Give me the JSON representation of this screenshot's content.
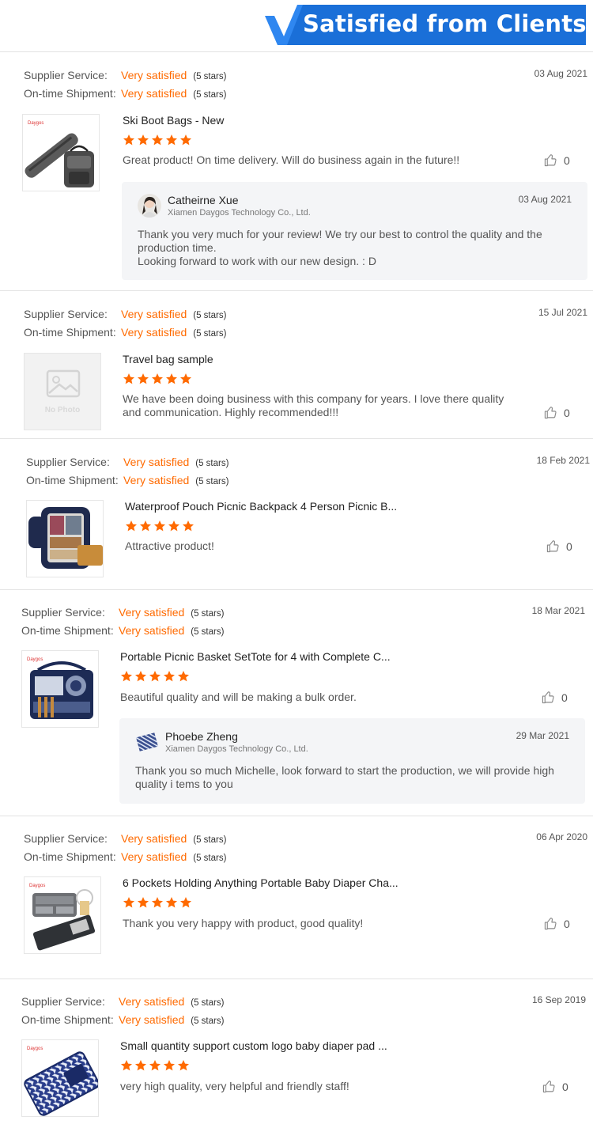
{
  "header": {
    "title": "Satisfied from Clients",
    "accent": "#1a6fd8"
  },
  "labels": {
    "supplier": "Supplier Service:",
    "shipment": "On-time Shipment:"
  },
  "reviews": [
    {
      "supplier_value": "Very satisfied",
      "supplier_count": "(5 stars)",
      "shipment_value": "Very satisfied",
      "shipment_count": "(5 stars)",
      "date": "03 Aug 2021",
      "product": "Ski Boot Bags - New",
      "rating": 5,
      "comment": "Great product! On time delivery. Will do business again in the future!!",
      "likes": "0",
      "reply": {
        "name": "Catheirne Xue",
        "company": "Xiamen Daygos Technology Co., Ltd.",
        "date": "03 Aug 2021",
        "text": "Thank you very much for your review! We try our best to control the quality and the production time.\nLooking forward to work with our new design. : D"
      }
    },
    {
      "supplier_value": "Very satisfied",
      "supplier_count": "(5 stars)",
      "shipment_value": "Very satisfied",
      "shipment_count": "(5 stars)",
      "date": "15 Jul 2021",
      "product": "Travel bag sample",
      "rating": 5,
      "comment": "We have been doing business with this company for years. I love there quality and communication. Highly recommended!!!",
      "likes": "0",
      "no_photo": "No Photo"
    },
    {
      "supplier_value": "Very satisfied",
      "supplier_count": "(5 stars)",
      "shipment_value": "Very satisfied",
      "shipment_count": "(5 stars)",
      "date": "18 Feb 2021",
      "product": "Waterproof Pouch Picnic Backpack 4 Person Picnic B...",
      "rating": 5,
      "comment": "Attractive product!",
      "likes": "0"
    },
    {
      "supplier_value": "Very satisfied",
      "supplier_count": "(5 stars)",
      "shipment_value": "Very satisfied",
      "shipment_count": "(5 stars)",
      "date": "18 Mar 2021",
      "product": "Portable Picnic Basket SetTote for 4 with Complete C...",
      "rating": 5,
      "comment": "Beautiful quality and will be making a bulk order.",
      "likes": "0",
      "reply": {
        "name": "Phoebe Zheng",
        "company": "Xiamen Daygos Technology Co., Ltd.",
        "date": "29 Mar 2021",
        "text": "Thank you so much Michelle, look forward to start the production, we will provide high quality i tems to you"
      }
    },
    {
      "supplier_value": "Very satisfied",
      "supplier_count": "(5 stars)",
      "shipment_value": "Very satisfied",
      "shipment_count": "(5 stars)",
      "date": "06 Apr 2020",
      "product": "6 Pockets Holding Anything Portable Baby Diaper Cha...",
      "rating": 5,
      "comment": "Thank you very happy with product, good quality!",
      "likes": "0"
    },
    {
      "supplier_value": "Very satisfied",
      "supplier_count": "(5 stars)",
      "shipment_value": "Very satisfied",
      "shipment_count": "(5 stars)",
      "date": "16 Sep 2019",
      "product": "Small quantity support custom logo baby diaper pad ...",
      "rating": 5,
      "comment": "very high quality, very helpful and friendly staff!",
      "likes": "0"
    }
  ],
  "colors": {
    "orange": "#ff6a00",
    "star": "#ff6a00"
  },
  "icons": {
    "like": "thumbs-up-icon",
    "star": "star-icon"
  }
}
